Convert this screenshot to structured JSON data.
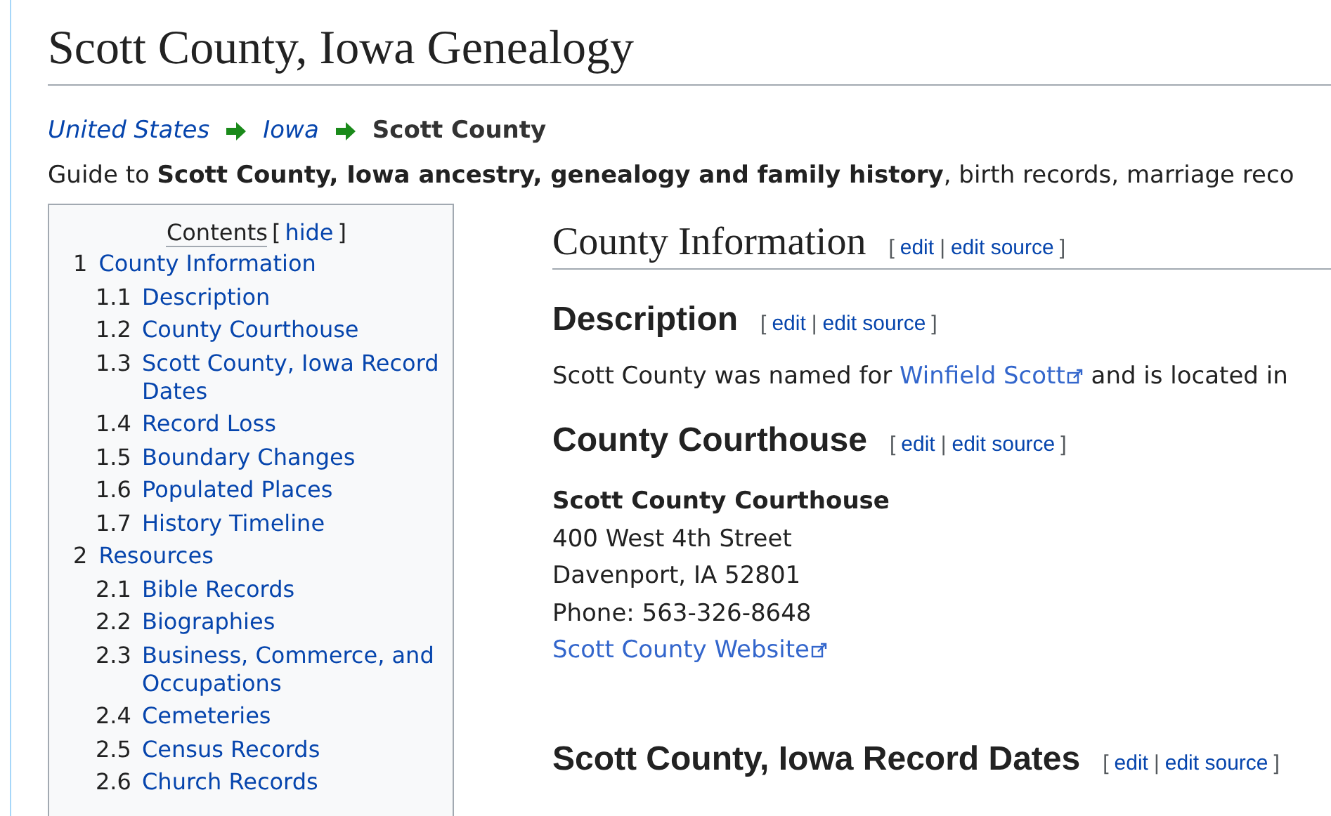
{
  "page": {
    "title": "Scott County, Iowa Genealogy",
    "breadcrumb": [
      {
        "label": "United States",
        "kind": "link"
      },
      {
        "label": "Iowa",
        "kind": "link"
      },
      {
        "label": "Scott County",
        "kind": "current"
      }
    ],
    "intro": "Guide to **Scott County, Iowa ancestry, genealogy and family history**, birth records, marriage reco"
  },
  "toc": {
    "title": "Contents",
    "toggle_open": "[",
    "toggle": "hide",
    "toggle_close": "]",
    "items": [
      {
        "number": "1",
        "label": "County Information",
        "children": [
          {
            "number": "1.1",
            "label": "Description"
          },
          {
            "number": "1.2",
            "label": "County Courthouse"
          },
          {
            "number": "1.3",
            "label": "Scott County, Iowa Record Dates"
          },
          {
            "number": "1.4",
            "label": "Record Loss"
          },
          {
            "number": "1.5",
            "label": "Boundary Changes"
          },
          {
            "number": "1.6",
            "label": "Populated Places"
          },
          {
            "number": "1.7",
            "label": "History Timeline"
          }
        ]
      },
      {
        "number": "2",
        "label": "Resources",
        "children": [
          {
            "number": "2.1",
            "label": "Bible Records"
          },
          {
            "number": "2.2",
            "label": "Biographies"
          },
          {
            "number": "2.3",
            "label": "Business, Commerce, and Occupations"
          },
          {
            "number": "2.4",
            "label": "Cemeteries"
          },
          {
            "number": "2.5",
            "label": "Census Records"
          },
          {
            "number": "2.6",
            "label": "Church Records"
          }
        ]
      }
    ]
  },
  "content": [
    {
      "kind": "h2",
      "title": "County Information",
      "edit": {
        "open": "[",
        "links": [
          "edit",
          "edit source"
        ],
        "separator": "|",
        "close": "]"
      }
    },
    {
      "kind": "h3",
      "title": "Description",
      "edit": {
        "open": "[",
        "links": [
          "edit",
          "edit source"
        ],
        "separator": "|",
        "close": "]"
      }
    },
    {
      "kind": "paragraph",
      "parts": [
        {
          "kind": "text",
          "text": "Scott County was named for "
        },
        {
          "kind": "external_link",
          "text": "Winfield Scott"
        },
        {
          "kind": "text",
          "text": " and is located in"
        }
      ]
    },
    {
      "kind": "h3",
      "title": "County Courthouse",
      "edit": {
        "open": "[",
        "links": [
          "edit",
          "edit source"
        ],
        "separator": "|",
        "close": "]"
      }
    },
    {
      "kind": "address",
      "lines": [
        {
          "kind": "bold",
          "text": "Scott County Courthouse"
        },
        {
          "kind": "plain",
          "text": "400 West 4th Street"
        },
        {
          "kind": "plain",
          "text": "Davenport, IA 52801"
        },
        {
          "kind": "plain",
          "text": "Phone: 563-326-8648"
        },
        {
          "kind": "external_link",
          "text": "Scott County Website"
        }
      ]
    },
    {
      "kind": "h3",
      "title": "Scott County, Iowa Record Dates",
      "edit": {
        "open": "[",
        "links": [
          "edit",
          "edit source"
        ],
        "separator": "|",
        "close": "]"
      }
    }
  ]
}
